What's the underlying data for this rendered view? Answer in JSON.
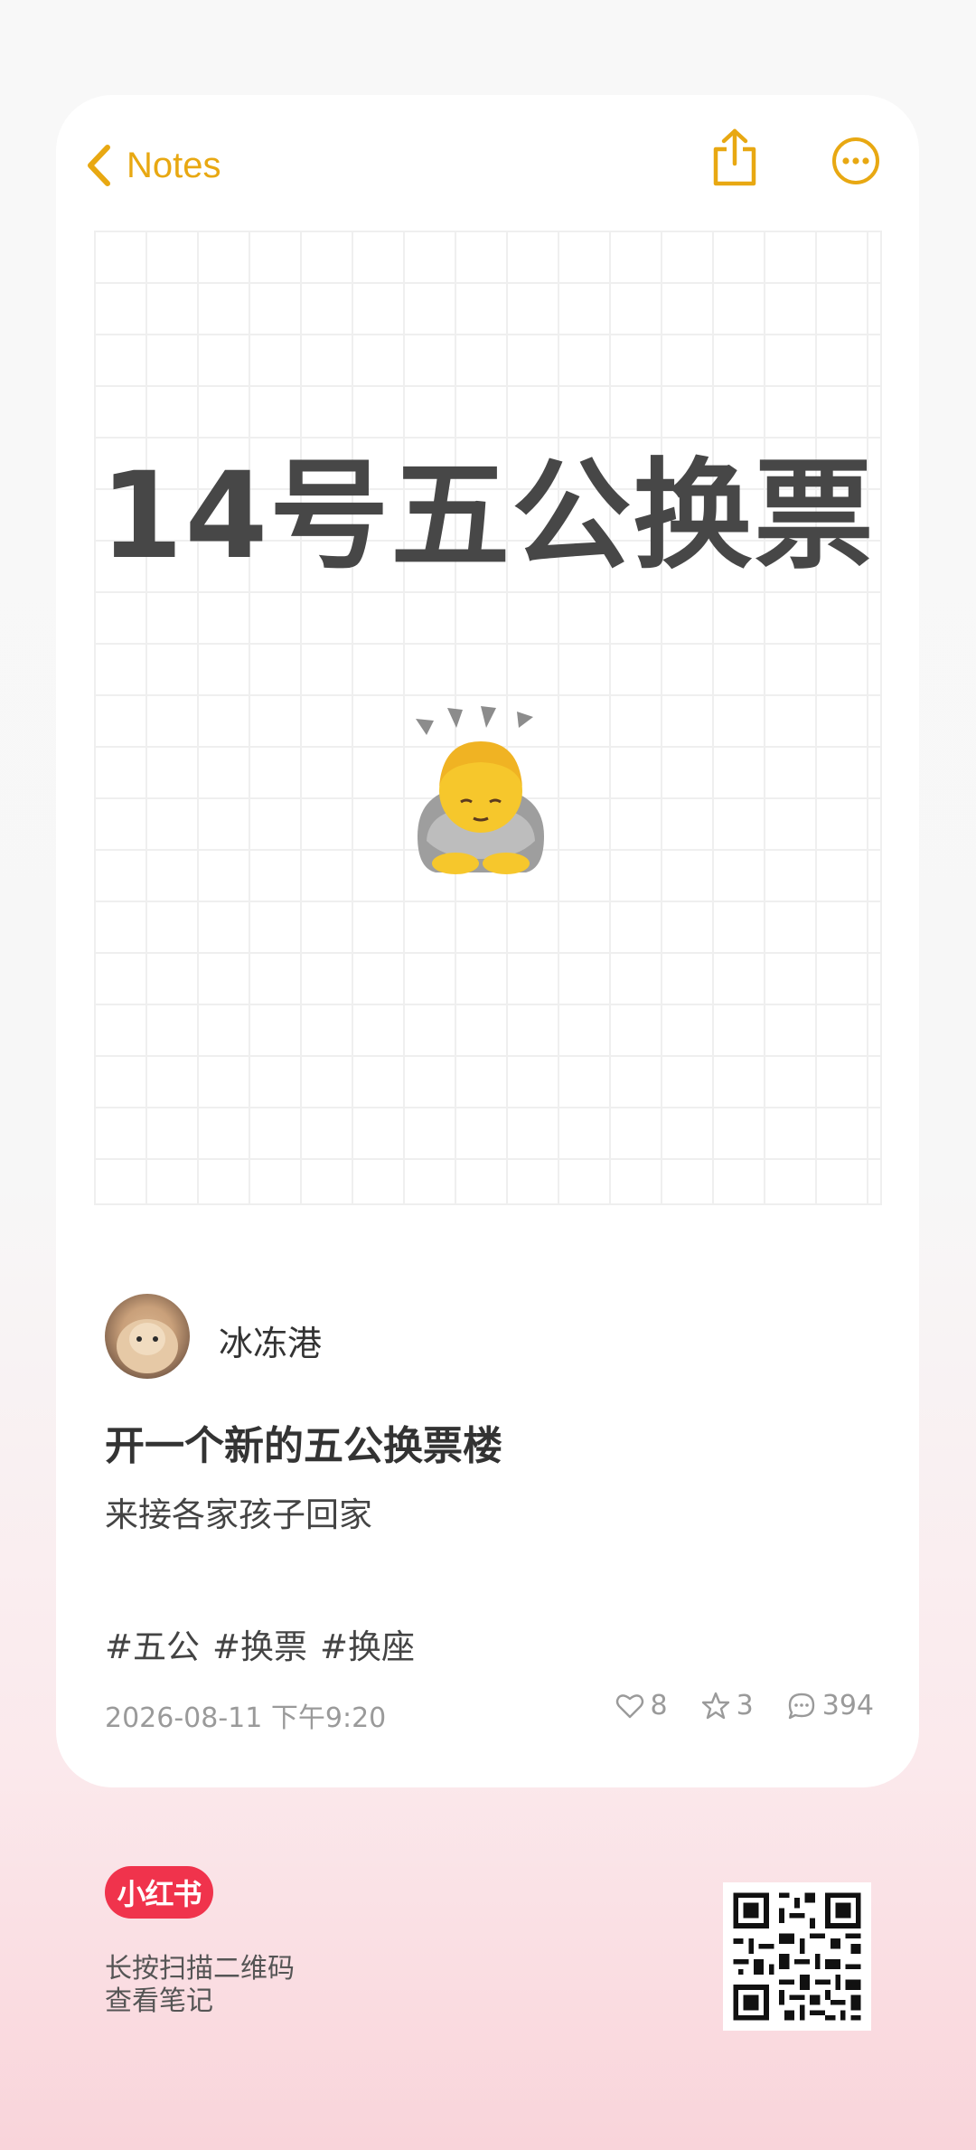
{
  "colors": {
    "accent": "#e8a812",
    "brand": "#f0334c",
    "title_text": "#474747",
    "muted": "#9a9a9a"
  },
  "nav": {
    "back_label": "Notes",
    "back_icon": "chevron-left-icon",
    "share_icon": "share-icon",
    "more_icon": "more-circle-icon"
  },
  "note": {
    "big_title": "14号五公换票",
    "emoji": "🙇‍♂️"
  },
  "post": {
    "author": "冰冻港",
    "title": "开一个新的五公换票楼",
    "subtitle": "来接各家孩子回家",
    "tags": [
      "#五公",
      "#换票",
      "#换座"
    ],
    "date": "2026-08-11 下午9:20",
    "likes": "8",
    "favorites": "3",
    "comments": "394"
  },
  "footer": {
    "brand": "小红书",
    "scan_line1": "长按扫描二维码",
    "scan_line2": "查看笔记"
  }
}
